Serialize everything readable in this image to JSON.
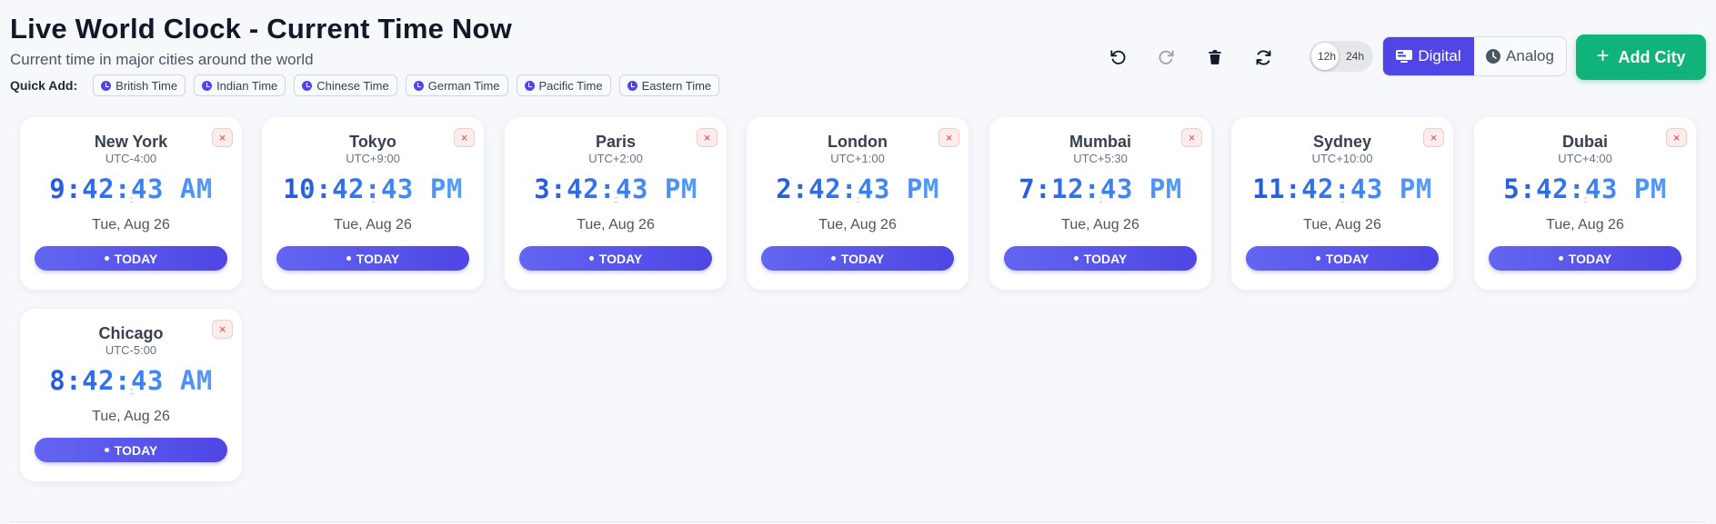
{
  "header": {
    "title": "Live World Clock - Current Time Now",
    "subtitle": "Current time in major cities around the world"
  },
  "quick_add": {
    "label": "Quick Add:",
    "items": [
      "British Time",
      "Indian Time",
      "Chinese Time",
      "German Time",
      "Pacific Time",
      "Eastern Time"
    ]
  },
  "toolbar": {
    "undo_icon": "undo-icon",
    "redo_icon": "redo-icon",
    "delete_icon": "trash-icon",
    "refresh_icon": "refresh-icon",
    "format_12": "12h",
    "format_24": "24h",
    "format_selected": "12h",
    "view_digital": "Digital",
    "view_analog": "Analog",
    "view_selected": "Digital",
    "add_city_label": "Add City"
  },
  "colors": {
    "accent": "#4f46e5",
    "add_button": "#10b37a",
    "time_text": "#3b6fe0",
    "close": "#ef4444"
  },
  "cards": [
    {
      "city": "New York",
      "utc": "UTC-4:00",
      "time": "9:42:43 AM",
      "date": "Tue, Aug 26",
      "badge": "TODAY"
    },
    {
      "city": "Tokyo",
      "utc": "UTC+9:00",
      "time": "10:42:43 PM",
      "date": "Tue, Aug 26",
      "badge": "TODAY"
    },
    {
      "city": "Paris",
      "utc": "UTC+2:00",
      "time": "3:42:43 PM",
      "date": "Tue, Aug 26",
      "badge": "TODAY"
    },
    {
      "city": "London",
      "utc": "UTC+1:00",
      "time": "2:42:43 PM",
      "date": "Tue, Aug 26",
      "badge": "TODAY"
    },
    {
      "city": "Mumbai",
      "utc": "UTC+5:30",
      "time": "7:12:43 PM",
      "date": "Tue, Aug 26",
      "badge": "TODAY"
    },
    {
      "city": "Sydney",
      "utc": "UTC+10:00",
      "time": "11:42:43 PM",
      "date": "Tue, Aug 26",
      "badge": "TODAY"
    },
    {
      "city": "Dubai",
      "utc": "UTC+4:00",
      "time": "5:42:43 PM",
      "date": "Tue, Aug 26",
      "badge": "TODAY"
    },
    {
      "city": "Chicago",
      "utc": "UTC-5:00",
      "time": "8:42:43 AM",
      "date": "Tue, Aug 26",
      "badge": "TODAY"
    }
  ],
  "close_symbol": "×",
  "drag_symbol": "::"
}
